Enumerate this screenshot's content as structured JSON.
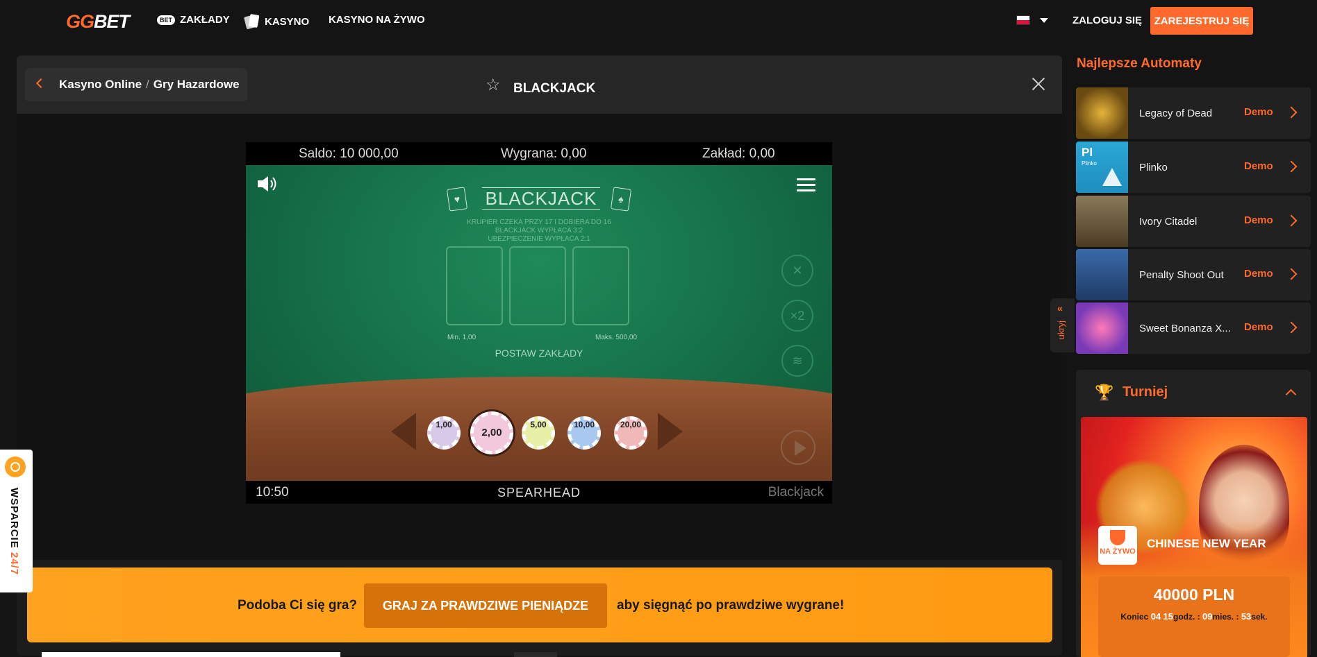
{
  "nav": {
    "logo_gg": "GG",
    "logo_bet": "BET",
    "bet_badge": "BET",
    "items": [
      "ZAKŁADY",
      "KASYNO",
      "KASYNO NA ŻYWO"
    ],
    "login": "ZALOGUJ SIĘ",
    "register": "ZAREJESTRUJ SIĘ"
  },
  "game_header": {
    "breadcrumb_1": "Kasyno Online",
    "breadcrumb_sep": "/",
    "breadcrumb_2": "Gry Hazardowe",
    "star": "☆",
    "title": "BLACKJACK"
  },
  "game": {
    "saldo_label": "Saldo:",
    "saldo_value": "10 000,00",
    "wygrana_label": "Wygrana:",
    "wygrana_value": "0,00",
    "zaklad_label": "Zakład:",
    "zaklad_value": "0,00",
    "logo": "BLACKJACK",
    "rules": [
      "KRUPIER CZEKA PRZY 17 I DOBIERA DO 16",
      "BLACKJACK WYPŁACA 3:2",
      "UBEZPIECZENIE WYPŁACA 2:1"
    ],
    "min": "Min. 1,00",
    "max": "Maks. 500,00",
    "prompt": "POSTAW ZAKŁADY",
    "side_buttons": [
      "✕",
      "×2",
      "≋"
    ],
    "chips": [
      {
        "value": "1,00",
        "color": "#d9c9e8"
      },
      {
        "value": "2,00",
        "color": "#f2c9dc"
      },
      {
        "value": "5,00",
        "color": "#e8f0a8"
      },
      {
        "value": "10,00",
        "color": "#a9c8f0"
      },
      {
        "value": "20,00",
        "color": "#f0b8b8"
      }
    ],
    "time": "10:50",
    "provider": "SPEARHEAD",
    "game_name": "Blackjack",
    "colors": {
      "felt": "#146b45",
      "wood": "#7a4124"
    }
  },
  "promo": {
    "left_text": "Podoba Ci się gra?",
    "button": "GRAJ ZA PRAWDZIWE PIENIĄDZE",
    "right_text": "aby sięgnąć po prawdziwe wygrane!"
  },
  "support": {
    "label": "WSPARCIE",
    "highlight": "24/7"
  },
  "sidebar": {
    "title": "Najlepsze Automaty",
    "hide_label": "ukryj",
    "hide_arrows": "«",
    "demo_label": "Demo",
    "slots": [
      {
        "name": "Legacy of Dead",
        "color": "#6b4a12"
      },
      {
        "name": "Plinko",
        "color": "#1f8fbf",
        "thumb_text": "Pl",
        "thumb_sub": "Plinko"
      },
      {
        "name": "Ivory Citadel",
        "color": "#4a3a22"
      },
      {
        "name": "Penalty Shoot Out",
        "color": "#1f3a66"
      },
      {
        "name": "Sweet Bonanza X...",
        "color": "#7a3ab8"
      }
    ],
    "tournament": {
      "title": "Turniej",
      "badge": "NA ŻYWO",
      "name": "CHINESE NEW YEAR",
      "prize": "40000 PLN",
      "ends_label": "Koniec",
      "days": "04",
      "hours": "15",
      "hours_unit": "godz. :",
      "minutes": "09",
      "minutes_unit": "mies. :",
      "seconds": "53",
      "seconds_unit": "sek."
    }
  }
}
